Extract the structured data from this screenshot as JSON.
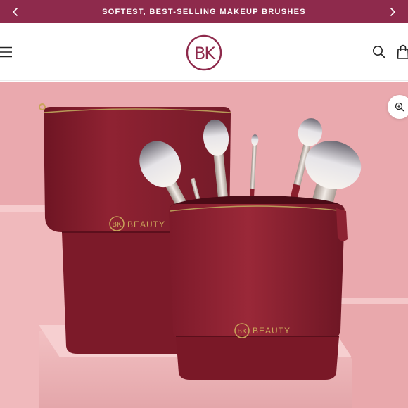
{
  "announcement": {
    "text": "SOFTEST, BEST-SELLING MAKEUP BRUSHES",
    "prev_icon": "chevron-left-icon",
    "next_icon": "chevron-right-icon"
  },
  "header": {
    "menu_icon": "hamburger-menu-icon",
    "logo_text": "BK",
    "search_icon": "search-icon",
    "cart_icon": "shopping-bag-icon"
  },
  "hero": {
    "brand_text_large": "BEAUTY",
    "brand_text_small": "BEAUTY",
    "brand_logo_text": "BK",
    "zoom_icon": "zoom-in-icon"
  },
  "colors": {
    "brand": "#8e2a4c",
    "background_pink": "#e9aaaf",
    "leather": "#8a1e2e",
    "gold": "#c9a45a"
  }
}
